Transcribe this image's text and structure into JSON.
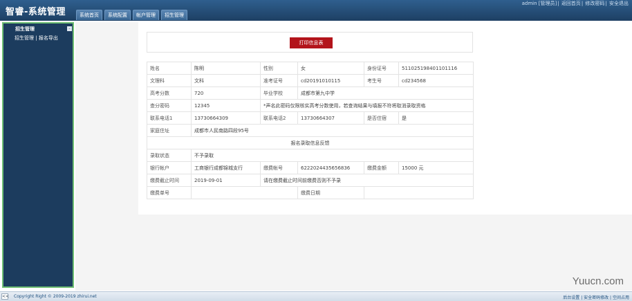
{
  "header": {
    "logo": "智睿-系统管理",
    "top_links": [
      "admin [管理员]",
      "返回首页",
      "修改密码",
      "安全退出"
    ],
    "nav_tabs": [
      "系统首页",
      "系统配置",
      "帐户管理",
      "招生管理"
    ]
  },
  "sidebar": {
    "title": "招生管理",
    "links": [
      "招生管理",
      "报名导出"
    ],
    "separator": "|",
    "toggle": "-"
  },
  "main": {
    "print_button": "打印信息表",
    "rows": [
      [
        "姓名",
        "陈明",
        "性别",
        "女",
        "身份证号",
        "511025198401101116"
      ],
      [
        "文理科",
        "文科",
        "准考证号",
        "cd20191010115",
        "考生号",
        "cd234568"
      ],
      [
        "高考分数",
        "720",
        "毕业学校",
        "成都市第九中学"
      ],
      [
        "查分密码",
        "12345",
        "*声名此密码仅限核实高考分数使用，若查询结果与填报不符将取消录取资格"
      ],
      [
        "联系电话1",
        "13730664309",
        "联系电话2",
        "13730664307",
        "是否住宿",
        "是"
      ],
      [
        "家庭住址",
        "成都市人民南路四段95号"
      ],
      [
        "报名录取信息反馈"
      ],
      [
        "录取状态",
        "不予录取"
      ],
      [
        "银行帐户",
        "工商银行成都锦城支行",
        "缴费帐号",
        "6222024435656836",
        "缴费金额",
        "15000 元"
      ],
      [
        "缴费截止时间",
        "2019-09-01",
        "请在缴费截止时间前缴费否则不予录"
      ],
      [
        "缴费单号",
        "",
        "缴费日期",
        ""
      ]
    ]
  },
  "footer": {
    "toggle": "<<",
    "copyright": "Copyright Right © 2009-2019 zhirui.net",
    "links": [
      "后台设置",
      "安全密码修改",
      "空间占用"
    ]
  },
  "watermark": "Yuucn.com"
}
